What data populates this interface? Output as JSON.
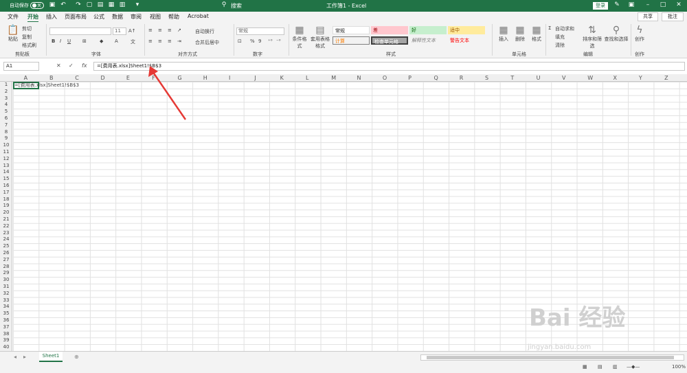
{
  "titlebar": {
    "autosave_label": "自动保存",
    "autosave_state": "关",
    "search_label": "搜索",
    "doc_title": "工作簿1 - Excel",
    "login_label": "登录",
    "accent_color": "#217346"
  },
  "tabs": [
    "文件",
    "开始",
    "插入",
    "页面布局",
    "公式",
    "数据",
    "审阅",
    "视图",
    "帮助",
    "Acrobat"
  ],
  "active_tab": "开始",
  "share_label": "共享",
  "comment_label": "批注",
  "ribbon": {
    "clipboard": {
      "paste": "粘贴",
      "cut": "剪切",
      "copy": "复制",
      "format_painter": "格式刷",
      "label": "剪贴板"
    },
    "font": {
      "font_size": "11",
      "label": "字体",
      "bold": "B",
      "italic": "I",
      "underline": "U"
    },
    "alignment": {
      "wrap": "自动换行",
      "merge": "合并后居中",
      "label": "对齐方式"
    },
    "number": {
      "format": "常规",
      "label": "数字"
    },
    "styles": {
      "conditional": "条件格式",
      "table": "套用表格格式",
      "cells": [
        "常规",
        "差",
        "好",
        "适中",
        "计算",
        "检查单元格",
        "解释性文本",
        "警告文本"
      ],
      "label": "样式"
    },
    "cells": {
      "insert": "插入",
      "delete": "删除",
      "format": "格式",
      "label": "单元格"
    },
    "editing": {
      "autosum": "自动求和",
      "fill": "填充",
      "clear": "清除",
      "sort": "排序和筛选",
      "find": "查找和选择",
      "label": "编辑"
    },
    "creative": {
      "create": "创作",
      "label": "创作"
    }
  },
  "formula_bar": {
    "name_box": "A1",
    "formula": "=[费用表.xlsx]Sheet1!$B$3"
  },
  "columns": [
    "A",
    "B",
    "C",
    "D",
    "E",
    "F",
    "G",
    "H",
    "I",
    "J",
    "K",
    "L",
    "M",
    "N",
    "O",
    "P",
    "Q",
    "R",
    "S",
    "T",
    "U",
    "V",
    "W",
    "X",
    "Y",
    "Z"
  ],
  "rows": [
    "1",
    "2",
    "3",
    "4",
    "5",
    "6",
    "7",
    "8",
    "9",
    "10",
    "11",
    "12",
    "13",
    "14",
    "15",
    "16",
    "17",
    "18",
    "19",
    "20",
    "21",
    "22",
    "23",
    "24",
    "25",
    "26",
    "27",
    "28",
    "29",
    "30",
    "31",
    "32",
    "33",
    "34",
    "35",
    "36",
    "37",
    "38",
    "39",
    "40"
  ],
  "cell_a1": "=[费用表.xlsx]Sheet1!$B$3",
  "sheet_tab": "Sheet1",
  "zoom": "100%",
  "watermark": {
    "brand": "Bai  经验",
    "url": "jingyan.baidu.com"
  }
}
